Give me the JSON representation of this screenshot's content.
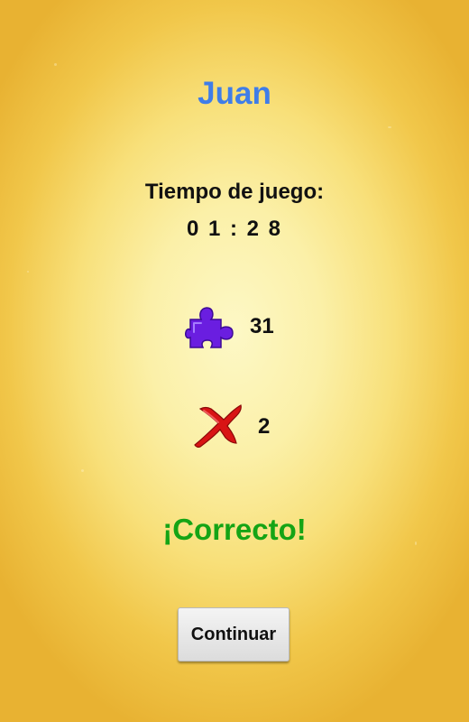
{
  "player": {
    "name": "Juan"
  },
  "game_time": {
    "label": "Tiempo de juego:",
    "value": "0 1 : 2 8"
  },
  "stats": {
    "pieces": {
      "icon": "puzzle-piece-icon",
      "value": "31",
      "color": "#6a1ee0"
    },
    "errors": {
      "icon": "red-x-icon",
      "value": "2",
      "color": "#d81414"
    }
  },
  "result": {
    "text": "¡Correcto!",
    "color": "#15a415"
  },
  "continue_button": {
    "label": "Continuar"
  },
  "colors": {
    "name": "#3f7de8",
    "background_center": "#fdf8c6",
    "background_edge": "#e8b232"
  }
}
